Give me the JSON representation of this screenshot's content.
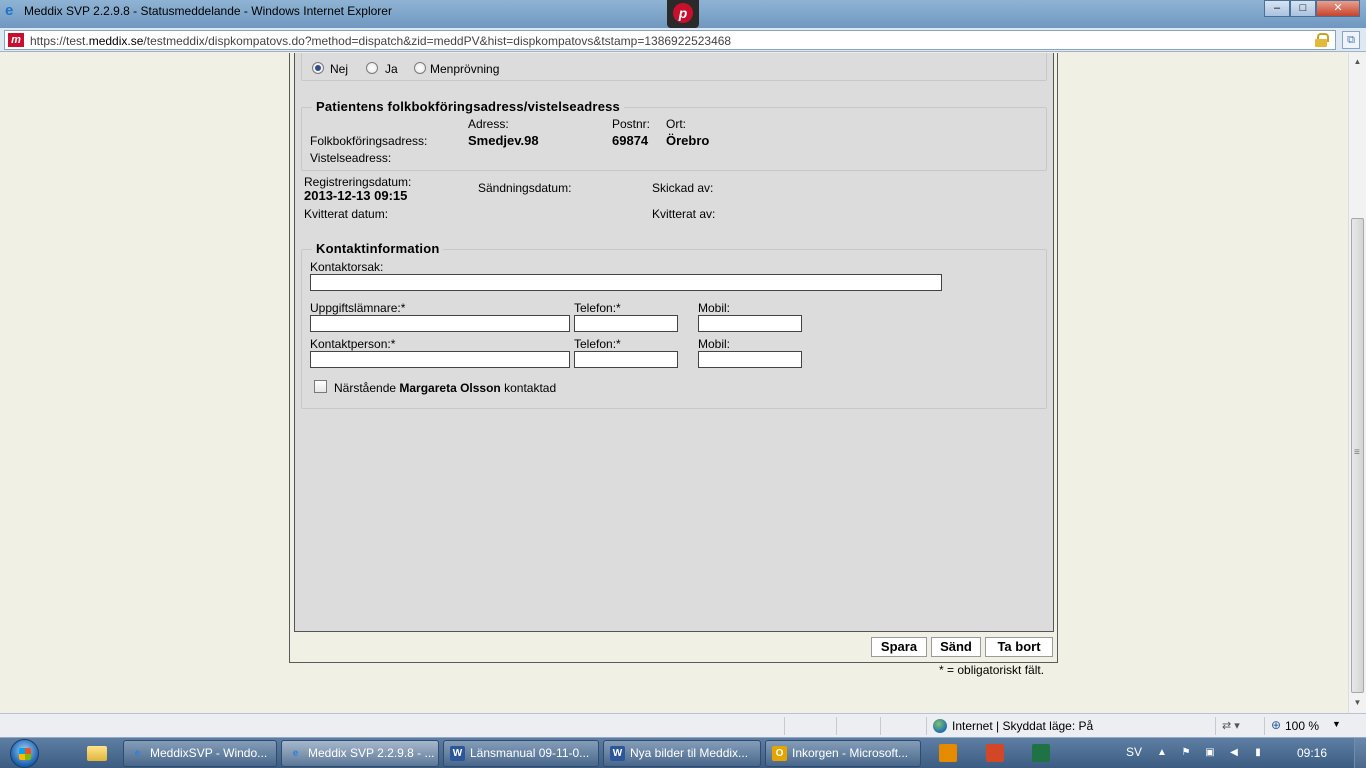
{
  "window": {
    "title": "Meddix SVP 2.2.9.8 - Statusmeddelande - Windows Internet Explorer",
    "minimize": "–",
    "maximize": "□",
    "close": "✕"
  },
  "address": {
    "url_prefix": "https://test.",
    "url_domain": "meddix.se",
    "url_rest": "/testmeddix/dispkompatovs.do?method=dispatch&zid=meddPV&hist=dispkompatovs&tstamp=1386922523468"
  },
  "radio_group": {
    "options": [
      "Nej",
      "Ja",
      "Menprövning"
    ],
    "selected": "Nej"
  },
  "address_section": {
    "legend": "Patientens folkbokföringsadress/vistelseadress",
    "col_address": "Adress:",
    "col_postnr": "Postnr:",
    "col_ort": "Ort:",
    "row1_label": "Folkbokföringsadress:",
    "row1_address": "Smedjev.98",
    "row1_postnr": "69874",
    "row1_ort": "Örebro",
    "row2_label": "Vistelseadress:"
  },
  "meta": {
    "reg_label": "Registreringsdatum:",
    "reg_value": "2013-12-13 09:15",
    "send_label": "Sändningsdatum:",
    "sent_by_label": "Skickad av:",
    "ack_date_label": "Kvitterat datum:",
    "ack_by_label": "Kvitterat av:"
  },
  "contact": {
    "legend": "Kontaktinformation",
    "reason_label": "Kontaktorsak:",
    "reason_value": "",
    "informant_label": "Uppgiftslämnare:*",
    "informant_value": "",
    "phone1_label": "Telefon:*",
    "phone1_value": "",
    "mobile1_label": "Mobil:",
    "mobile1_value": "",
    "contact_person_label": "Kontaktperson:*",
    "contact_person_value": "",
    "phone2_label": "Telefon:*",
    "phone2_value": "",
    "mobile2_label": "Mobil:",
    "mobile2_value": "",
    "relative_prefix": "Närstående",
    "relative_name": "Margareta Olsson",
    "relative_suffix": "kontaktad"
  },
  "buttons": {
    "save": "Spara",
    "send": "Sänd",
    "delete": "Ta bort"
  },
  "footnote": "* = obligatoriskt fält.",
  "statusbar": {
    "zone": "Internet | Skyddat läge: På",
    "zoom": "100 %"
  },
  "taskbar": {
    "items": [
      "MeddixSVP - Windo...",
      "Meddix SVP 2.2.9.8 - ...",
      "Länsmanual 09-11-0...",
      "Nya bilder til Meddix...",
      "Inkorgen - Microsoft..."
    ],
    "lang": "SV",
    "clock": "09:16"
  }
}
